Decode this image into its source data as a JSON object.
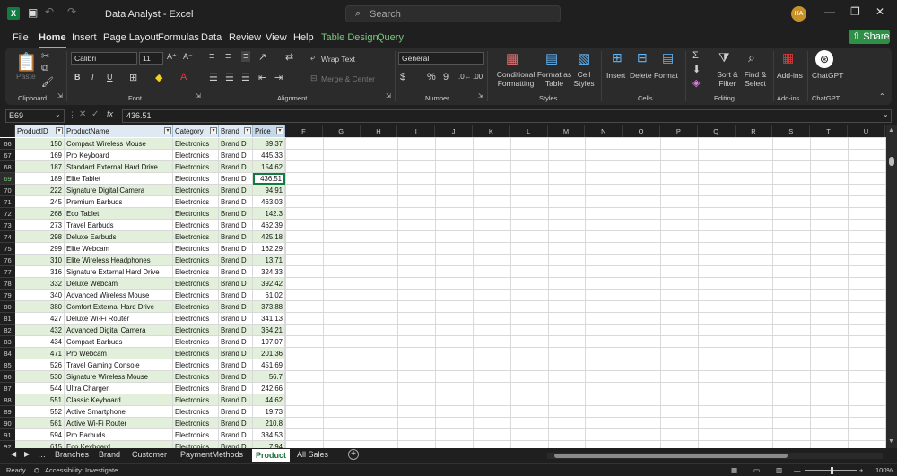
{
  "window": {
    "title": "Data Analyst  -  Excel",
    "search_placeholder": "Search",
    "user_initials": "HA"
  },
  "menu": [
    "File",
    "Home",
    "Insert",
    "Page Layout",
    "Formulas",
    "Data",
    "Review",
    "View",
    "Help",
    "Table Design",
    "Query"
  ],
  "share_label": "Share",
  "ribbon": {
    "paste": "Paste",
    "clipboard": "Clipboard",
    "font_name": "Calibri",
    "font_size": "11",
    "font": "Font",
    "alignment": "Alignment",
    "wrap_text": "Wrap Text",
    "merge_center": "Merge & Center",
    "number_format": "General",
    "number": "Number",
    "conditional_formatting": "Conditional Formatting",
    "format_as_table": "Format as Table",
    "cell_styles": "Cell Styles",
    "styles": "Styles",
    "insert": "Insert",
    "delete": "Delete",
    "format": "Format",
    "cells": "Cells",
    "sort_filter": "Sort & Filter",
    "find_select": "Find & Select",
    "editing": "Editing",
    "add_ins": "Add-ins",
    "add_ins_group": "Add-ins",
    "chatgpt": "ChatGPT",
    "chatgpt_group": "ChatGPT"
  },
  "formula_bar": {
    "name_box": "E69",
    "fx": "fx",
    "value": "436.51"
  },
  "columns": {
    "table_headers": [
      "ProductID",
      "ProductName",
      "Category",
      "Brand",
      "Price"
    ],
    "letters": [
      "F",
      "G",
      "H",
      "I",
      "J",
      "K",
      "L",
      "M",
      "N",
      "O",
      "P",
      "Q",
      "R",
      "S",
      "T",
      "U"
    ]
  },
  "rows": [
    {
      "n": "66",
      "id": "150",
      "name": "Compact Wireless Mouse",
      "cat": "Electronics",
      "brand": "Brand D",
      "price": "89.37"
    },
    {
      "n": "67",
      "id": "169",
      "name": "Pro Keyboard",
      "cat": "Electronics",
      "brand": "Brand D",
      "price": "445.33"
    },
    {
      "n": "68",
      "id": "187",
      "name": "Standard External Hard Drive",
      "cat": "Electronics",
      "brand": "Brand D",
      "price": "154.62"
    },
    {
      "n": "69",
      "id": "189",
      "name": "Elite Tablet",
      "cat": "Electronics",
      "brand": "Brand D",
      "price": "436.51"
    },
    {
      "n": "70",
      "id": "222",
      "name": "Signature Digital Camera",
      "cat": "Electronics",
      "brand": "Brand D",
      "price": "94.91"
    },
    {
      "n": "71",
      "id": "245",
      "name": "Premium Earbuds",
      "cat": "Electronics",
      "brand": "Brand D",
      "price": "463.03"
    },
    {
      "n": "72",
      "id": "268",
      "name": "Eco Tablet",
      "cat": "Electronics",
      "brand": "Brand D",
      "price": "142.3"
    },
    {
      "n": "73",
      "id": "273",
      "name": "Travel Earbuds",
      "cat": "Electronics",
      "brand": "Brand D",
      "price": "462.39"
    },
    {
      "n": "74",
      "id": "298",
      "name": "Deluxe Earbuds",
      "cat": "Electronics",
      "brand": "Brand D",
      "price": "425.18"
    },
    {
      "n": "75",
      "id": "299",
      "name": "Elite Webcam",
      "cat": "Electronics",
      "brand": "Brand D",
      "price": "162.29"
    },
    {
      "n": "76",
      "id": "310",
      "name": "Elite Wireless Headphones",
      "cat": "Electronics",
      "brand": "Brand D",
      "price": "13.71"
    },
    {
      "n": "77",
      "id": "316",
      "name": "Signature External Hard Drive",
      "cat": "Electronics",
      "brand": "Brand D",
      "price": "324.33"
    },
    {
      "n": "78",
      "id": "332",
      "name": "Deluxe Webcam",
      "cat": "Electronics",
      "brand": "Brand D",
      "price": "392.42"
    },
    {
      "n": "79",
      "id": "340",
      "name": "Advanced Wireless Mouse",
      "cat": "Electronics",
      "brand": "Brand D",
      "price": "61.02"
    },
    {
      "n": "80",
      "id": "380",
      "name": "Comfort External Hard Drive",
      "cat": "Electronics",
      "brand": "Brand D",
      "price": "373.88"
    },
    {
      "n": "81",
      "id": "427",
      "name": "Deluxe Wi-Fi Router",
      "cat": "Electronics",
      "brand": "Brand D",
      "price": "341.13"
    },
    {
      "n": "82",
      "id": "432",
      "name": "Advanced Digital Camera",
      "cat": "Electronics",
      "brand": "Brand D",
      "price": "364.21"
    },
    {
      "n": "83",
      "id": "434",
      "name": "Compact Earbuds",
      "cat": "Electronics",
      "brand": "Brand D",
      "price": "197.07"
    },
    {
      "n": "84",
      "id": "471",
      "name": "Pro Webcam",
      "cat": "Electronics",
      "brand": "Brand D",
      "price": "201.36"
    },
    {
      "n": "85",
      "id": "526",
      "name": "Travel Gaming Console",
      "cat": "Electronics",
      "brand": "Brand D",
      "price": "451.69"
    },
    {
      "n": "86",
      "id": "530",
      "name": "Signature Wireless Mouse",
      "cat": "Electronics",
      "brand": "Brand D",
      "price": "56.7"
    },
    {
      "n": "87",
      "id": "544",
      "name": "Ultra Charger",
      "cat": "Electronics",
      "brand": "Brand D",
      "price": "242.66"
    },
    {
      "n": "88",
      "id": "551",
      "name": "Classic Keyboard",
      "cat": "Electronics",
      "brand": "Brand D",
      "price": "44.62"
    },
    {
      "n": "89",
      "id": "552",
      "name": "Active Smartphone",
      "cat": "Electronics",
      "brand": "Brand D",
      "price": "19.73"
    },
    {
      "n": "90",
      "id": "561",
      "name": "Active Wi-Fi Router",
      "cat": "Electronics",
      "brand": "Brand D",
      "price": "210.8"
    },
    {
      "n": "91",
      "id": "594",
      "name": "Pro Earbuds",
      "cat": "Electronics",
      "brand": "Brand D",
      "price": "384.53"
    },
    {
      "n": "92",
      "id": "615",
      "name": "Eco Keyboard",
      "cat": "Electronics",
      "brand": "Brand D",
      "price": "7.94"
    }
  ],
  "sheets": [
    "Branches",
    "Brand",
    "Customer",
    "PaymentMethods",
    "Product",
    "All Sales"
  ],
  "active_sheet": "Product",
  "status": {
    "ready": "Ready",
    "accessibility": "Accessibility: Investigate",
    "zoom": "100%"
  },
  "colors": {
    "accent": "#7bc67e",
    "band": "#e2efda",
    "header_bg": "#dfe9f3",
    "selected": "#107c41"
  }
}
